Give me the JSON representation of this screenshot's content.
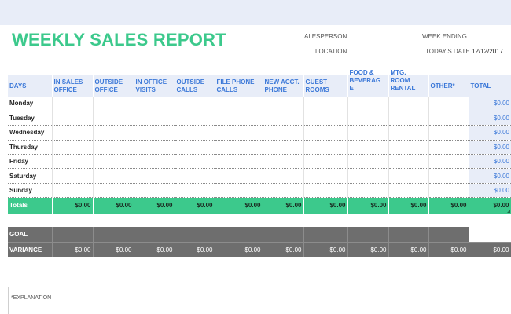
{
  "report": {
    "title": "WEEKLY SALES REPORT",
    "salesperson_label": "ALESPERSON",
    "week_ending_label": "WEEK ENDING",
    "location_label": "LOCATION",
    "todays_date_label": "TODAY'S DATE",
    "todays_date_value": "12/12/2017"
  },
  "table": {
    "headers": [
      {
        "label": "DAYS"
      },
      {
        "label": "IN SALES OFFICE"
      },
      {
        "label": "OUTSIDE OFFICE"
      },
      {
        "label": "IN OFFICE VISITS"
      },
      {
        "label": "OUTSIDE CALLS"
      },
      {
        "label": "FILE PHONE CALLS"
      },
      {
        "label": "NEW ACCT. PHONE"
      },
      {
        "label": "GUEST ROOMS"
      },
      {
        "label": "FOOD & BEVERAG E"
      },
      {
        "label": "MTG. ROOM RENTAL"
      },
      {
        "label": "OTHER*"
      },
      {
        "label": "TOTAL"
      }
    ],
    "days": [
      {
        "name": "Monday",
        "total": "$0.00"
      },
      {
        "name": "Tuesday",
        "total": "$0.00"
      },
      {
        "name": "Wednesday",
        "total": "$0.00"
      },
      {
        "name": "Thursday",
        "total": "$0.00"
      },
      {
        "name": "Friday",
        "total": "$0.00"
      },
      {
        "name": "Saturday",
        "total": "$0.00"
      },
      {
        "name": "Sunday",
        "total": "$0.00"
      }
    ],
    "totals": {
      "label": "Totals",
      "values": [
        "$0.00",
        "$0.00",
        "$0.00",
        "$0.00",
        "$0.00",
        "$0.00",
        "$0.00",
        "$0.00",
        "$0.00",
        "$0.00",
        "$0.00"
      ]
    },
    "goal_label": "GOAL",
    "variance": {
      "label": "VARIANCE",
      "values": [
        "$0.00",
        "$0.00",
        "$0.00",
        "$0.00",
        "$0.00",
        "$0.00",
        "$0.00",
        "$0.00",
        "$0.00",
        "$0.00",
        "$0.00"
      ]
    }
  },
  "explanation": {
    "label": "*EXPLANATION"
  },
  "colors": {
    "accent_green": "#3cc98c",
    "header_blue": "#3b78d8",
    "header_bg": "#e8edf8",
    "goal_gray": "#6e6e6e"
  }
}
